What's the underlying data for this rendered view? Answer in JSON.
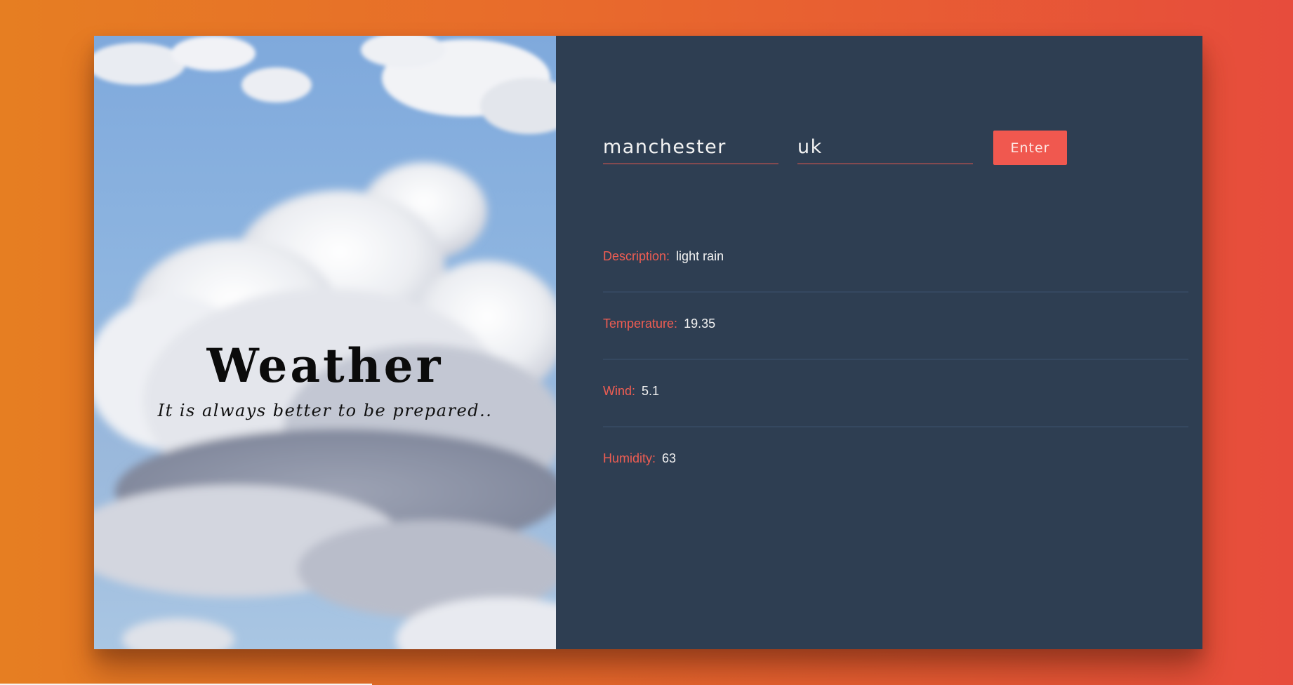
{
  "hero": {
    "title": "Weather",
    "subtitle": "It is always better to be prepared.."
  },
  "form": {
    "city_value": "manchester",
    "country_value": "uk",
    "enter_label": "Enter"
  },
  "results": [
    {
      "label": "Description:",
      "value": "light rain"
    },
    {
      "label": "Temperature:",
      "value": "19.35"
    },
    {
      "label": "Wind:",
      "value": "5.1"
    },
    {
      "label": "Humidity:",
      "value": "63"
    }
  ],
  "colors": {
    "accent": "#f0584f",
    "panel_bg": "#2e3e52",
    "page_gradient_start": "#e67e22",
    "page_gradient_end": "#e74c3c"
  }
}
